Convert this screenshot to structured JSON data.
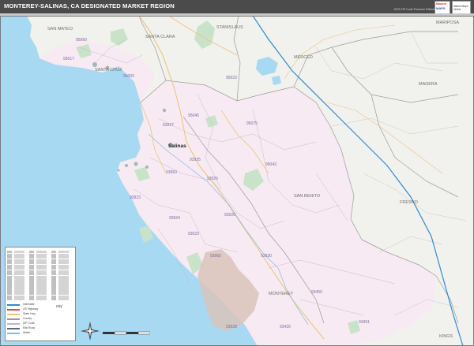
{
  "header": {
    "title": "MONTEREY-SALINAS, CA DESIGNATED MARKET REGION",
    "edition": "2022 ZIP Code Premium Edition"
  },
  "logo": {
    "line1": "Market",
    "line2": "MAPS",
    "badge": "Market Maps Online"
  },
  "colors": {
    "ocean": "#a8d9f2",
    "region_land": "#f7eaf2",
    "outside_land": "#f1f1ed",
    "zip_line": "#c4b5c9",
    "county_line": "#9b9b9b",
    "forest": "#c9e3c9",
    "park_tan": "#d9c4bb",
    "highway": "#2f8bd0",
    "road": "#ecc67b",
    "river": "#86b9e2"
  },
  "map": {
    "counties": [
      {
        "name": "SAN MATEO"
      },
      {
        "name": "SANTA CLARA"
      },
      {
        "name": "STANISLAUS"
      },
      {
        "name": "MARIPOSA"
      },
      {
        "name": "MERCED"
      },
      {
        "name": "SANTA CRUZ"
      },
      {
        "name": "MADERA"
      },
      {
        "name": "SAN BENITO"
      },
      {
        "name": "FRESNO"
      },
      {
        "name": "MONTEREY"
      },
      {
        "name": "KINGS"
      }
    ],
    "cities": [
      {
        "name": "Salinas"
      }
    ],
    "zips": [
      {
        "code": "95060"
      },
      {
        "code": "95023"
      },
      {
        "code": "95003"
      },
      {
        "code": "95017"
      },
      {
        "code": "95045"
      },
      {
        "code": "95075"
      },
      {
        "code": "93927"
      },
      {
        "code": "93950"
      },
      {
        "code": "93925"
      },
      {
        "code": "93926"
      },
      {
        "code": "93923"
      },
      {
        "code": "93924"
      },
      {
        "code": "95043"
      },
      {
        "code": "93920"
      },
      {
        "code": "93450"
      },
      {
        "code": "93930"
      },
      {
        "code": "93451"
      },
      {
        "code": "93426"
      },
      {
        "code": "93928"
      },
      {
        "code": "93023"
      },
      {
        "code": "93960"
      }
    ]
  },
  "legend": {
    "city_label": "City",
    "keys": [
      {
        "label": "Interstate",
        "color": "#2f8bd0"
      },
      {
        "label": "US Highway",
        "color": "#d44a4a"
      },
      {
        "label": "State Hwy",
        "color": "#ecc67b"
      },
      {
        "label": "County",
        "color": "#9b9b9b"
      },
      {
        "label": "ZIP Code",
        "color": "#c4b5c9"
      },
      {
        "label": "Rail Road",
        "color": "#666666"
      },
      {
        "label": "Water",
        "color": "#86b9e2"
      }
    ]
  }
}
